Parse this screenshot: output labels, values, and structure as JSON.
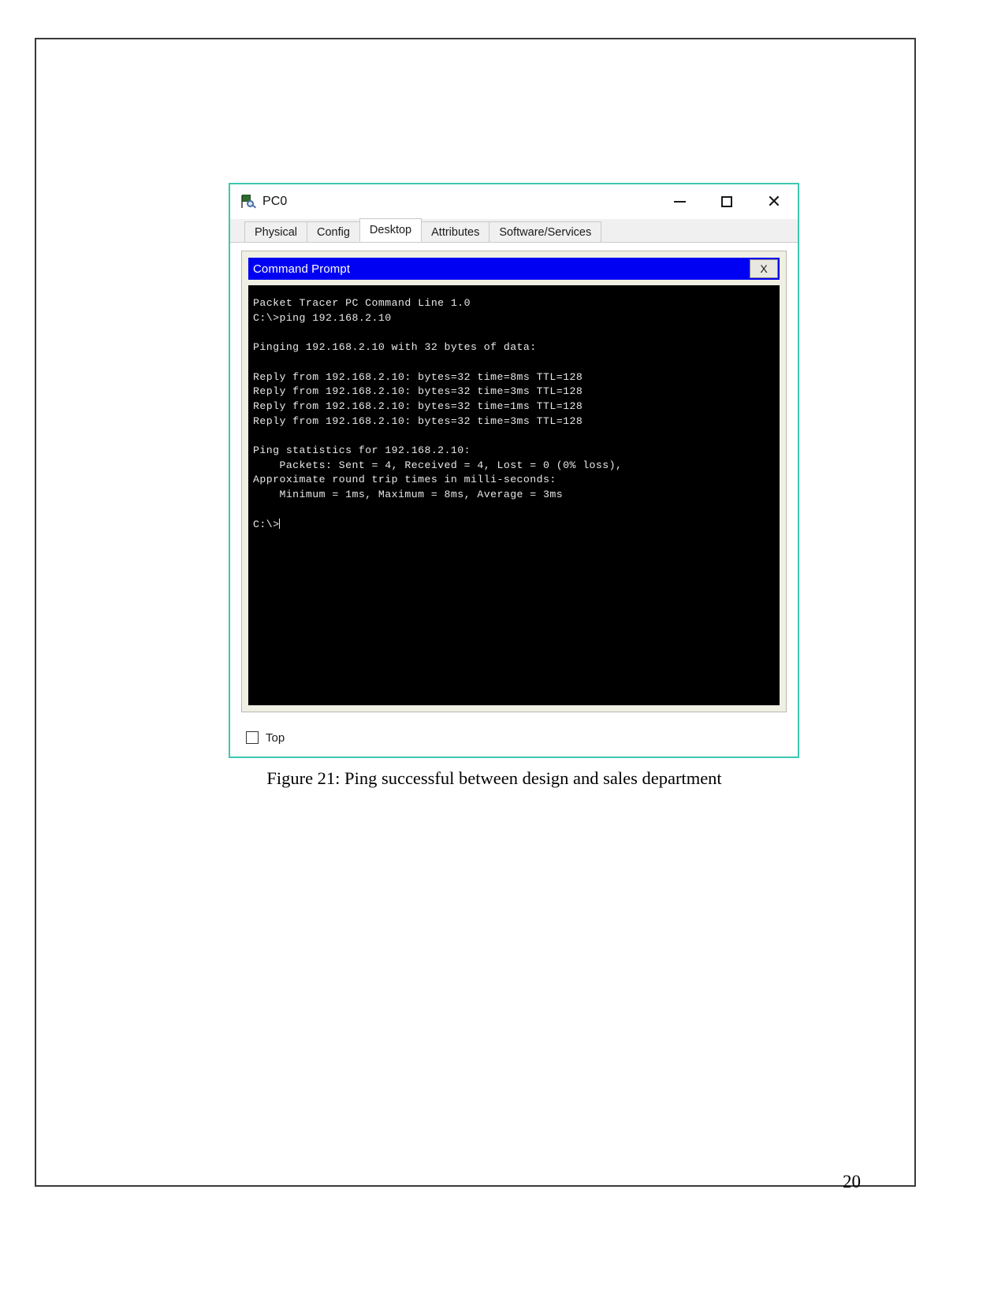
{
  "document": {
    "caption": "Figure 21: Ping successful between design and sales department",
    "page_number": "20"
  },
  "window": {
    "title": "PC0",
    "icon": "packet-tracer-pc-icon",
    "controls": {
      "minimize": "—",
      "maximize": "☐",
      "close": "✕"
    },
    "accent_border_color": "#3ec8b0"
  },
  "tabs": [
    {
      "label": "Physical",
      "active": false
    },
    {
      "label": "Config",
      "active": false
    },
    {
      "label": "Desktop",
      "active": true
    },
    {
      "label": "Attributes",
      "active": false
    },
    {
      "label": "Software/Services",
      "active": false
    }
  ],
  "command_prompt": {
    "title": "Command Prompt",
    "titlebar_color": "#0000f2",
    "close_button_label": "X",
    "terminal": {
      "background": "#000000",
      "foreground": "#e8e8e8",
      "lines": [
        "Packet Tracer PC Command Line 1.0",
        "C:\\>ping 192.168.2.10",
        "",
        "Pinging 192.168.2.10 with 32 bytes of data:",
        "",
        "Reply from 192.168.2.10: bytes=32 time=8ms TTL=128",
        "Reply from 192.168.2.10: bytes=32 time=3ms TTL=128",
        "Reply from 192.168.2.10: bytes=32 time=1ms TTL=128",
        "Reply from 192.168.2.10: bytes=32 time=3ms TTL=128",
        "",
        "Ping statistics for 192.168.2.10:",
        "    Packets: Sent = 4, Received = 4, Lost = 0 (0% loss),",
        "Approximate round trip times in milli-seconds:",
        "    Minimum = 1ms, Maximum = 8ms, Average = 3ms",
        ""
      ],
      "prompt": "C:\\>"
    }
  },
  "bottom": {
    "top_checkbox_label": "Top",
    "top_checkbox_checked": false
  }
}
